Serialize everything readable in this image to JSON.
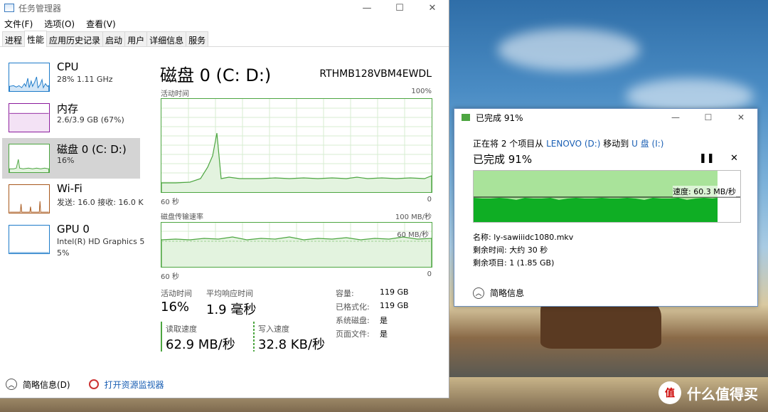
{
  "task_manager": {
    "title": "任务管理器",
    "window_buttons": [
      "—",
      "☐",
      "✕"
    ],
    "menu": [
      "文件(F)",
      "选项(O)",
      "查看(V)"
    ],
    "tabs": [
      "进程",
      "性能",
      "应用历史记录",
      "启动",
      "用户",
      "详细信息",
      "服务"
    ],
    "active_tab": "性能",
    "sidebar": [
      {
        "name": "CPU",
        "sub": "28% 1.11 GHz",
        "sub2": ""
      },
      {
        "name": "内存",
        "sub": "2.6/3.9 GB (67%)",
        "sub2": ""
      },
      {
        "name": "磁盘 0 (C: D:)",
        "sub": "16%",
        "sub2": ""
      },
      {
        "name": "Wi-Fi",
        "sub": "发送: 16.0  接收: 16.0 K",
        "sub2": ""
      },
      {
        "name": "GPU 0",
        "sub": "Intel(R) HD Graphics 5",
        "sub2": "5%"
      }
    ],
    "colors": {
      "cpu": "#1e7bc9",
      "memory": "#8b1a9c",
      "disk": "#4da641",
      "wifi": "#a8581c",
      "gpu": "#1e7bc9"
    },
    "main": {
      "title": "磁盘 0 (C: D:)",
      "model": "RTHMB128VBM4EWDL",
      "graph1_label": "活动时间",
      "graph1_max": "100%",
      "graph1_xleft": "60 秒",
      "graph1_xright": "0",
      "graph2_label": "磁盘传输速率",
      "graph2_max": "100 MB/秒",
      "graph2_ref": "60 MB/秒",
      "graph2_xleft": "60 秒",
      "graph2_xright": "0",
      "activity_label": "活动时间",
      "activity_value": "16%",
      "response_label": "平均响应时间",
      "response_value": "1.9 毫秒",
      "read_label": "读取速度",
      "read_value": "62.9 MB/秒",
      "write_label": "写入速度",
      "write_value": "32.8 KB/秒",
      "props": [
        {
          "k": "容量:",
          "v": "119 GB"
        },
        {
          "k": "已格式化:",
          "v": "119 GB"
        },
        {
          "k": "系统磁盘:",
          "v": "是"
        },
        {
          "k": "页面文件:",
          "v": "是"
        }
      ]
    },
    "footer": {
      "brief": "简略信息(D)",
      "resmon": "打开资源监视器"
    }
  },
  "copy_dialog": {
    "title": "已完成 91%",
    "window_buttons": [
      "—",
      "☐",
      "✕"
    ],
    "line1_prefix": "正在将 2 个项目从 ",
    "from": "LENOVO (D:)",
    "line1_mid": " 移动到 ",
    "to": "U 盘 (I:)",
    "progress_text": "已完成 91%",
    "progress": 0.91,
    "speed": "速度: 60.3 MB/秒",
    "name_label": "名称:",
    "name": "ly-sawiiidc1080.mkv",
    "time_label": "剩余时间:",
    "time": "大约 30 秒",
    "items_label": "剩余项目:",
    "items": "1 (1.85 GB)",
    "footer": "简略信息",
    "pause": "❚❚",
    "cancel": "✕"
  },
  "watermark": {
    "text": "什么值得买",
    "glyph": "值"
  }
}
